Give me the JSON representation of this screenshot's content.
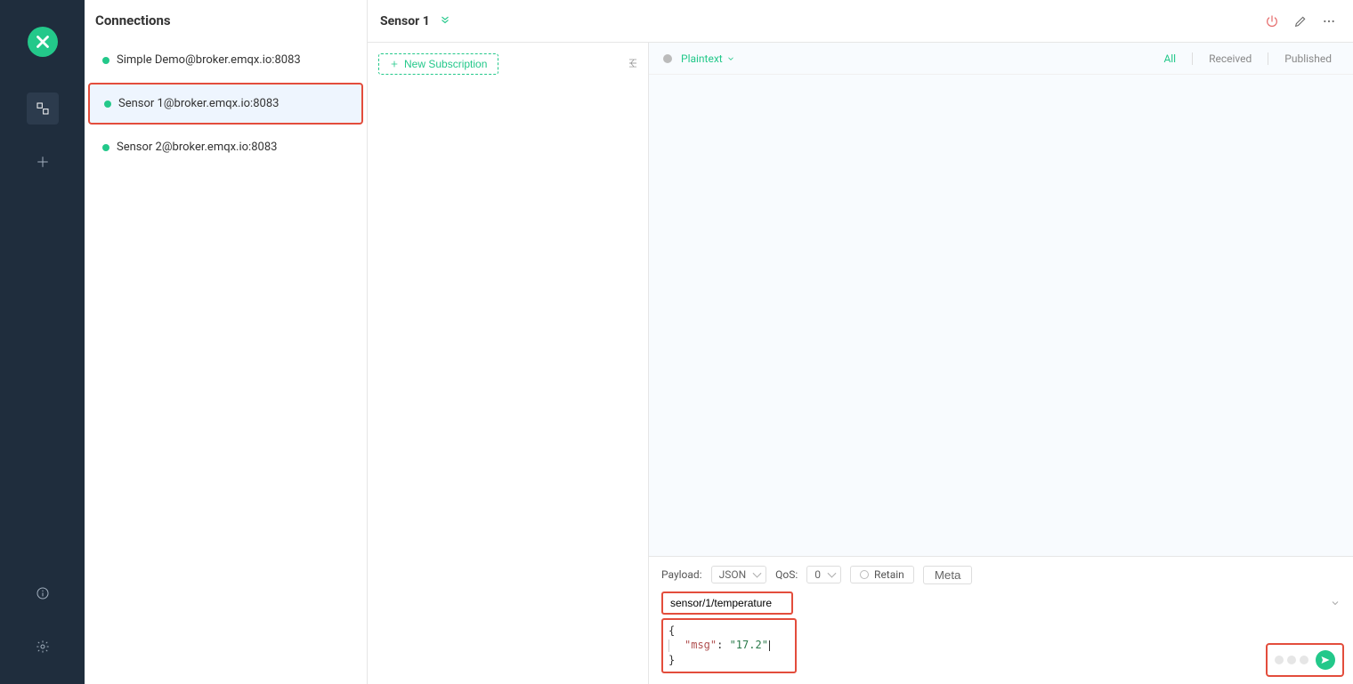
{
  "sidebar": {
    "title": "Connections",
    "connections": [
      {
        "label": "Simple Demo@broker.emqx.io:8083"
      },
      {
        "label": "Sensor 1@broker.emqx.io:8083"
      },
      {
        "label": "Sensor 2@broker.emqx.io:8083"
      }
    ]
  },
  "topbar": {
    "title": "Sensor 1"
  },
  "subscription": {
    "new_label": "New Subscription"
  },
  "messages": {
    "format": "Plaintext",
    "filters": {
      "all": "All",
      "received": "Received",
      "published": "Published"
    }
  },
  "publish": {
    "payload_label": "Payload:",
    "payload_format": "JSON",
    "qos_label": "QoS:",
    "qos_value": "0",
    "retain_label": "Retain",
    "meta_label": "Meta",
    "topic": "sensor/1/temperature",
    "payload_json": {
      "open": "{",
      "key": "\"msg\"",
      "colon": ": ",
      "value": "\"17.2\"",
      "close": "}"
    }
  }
}
